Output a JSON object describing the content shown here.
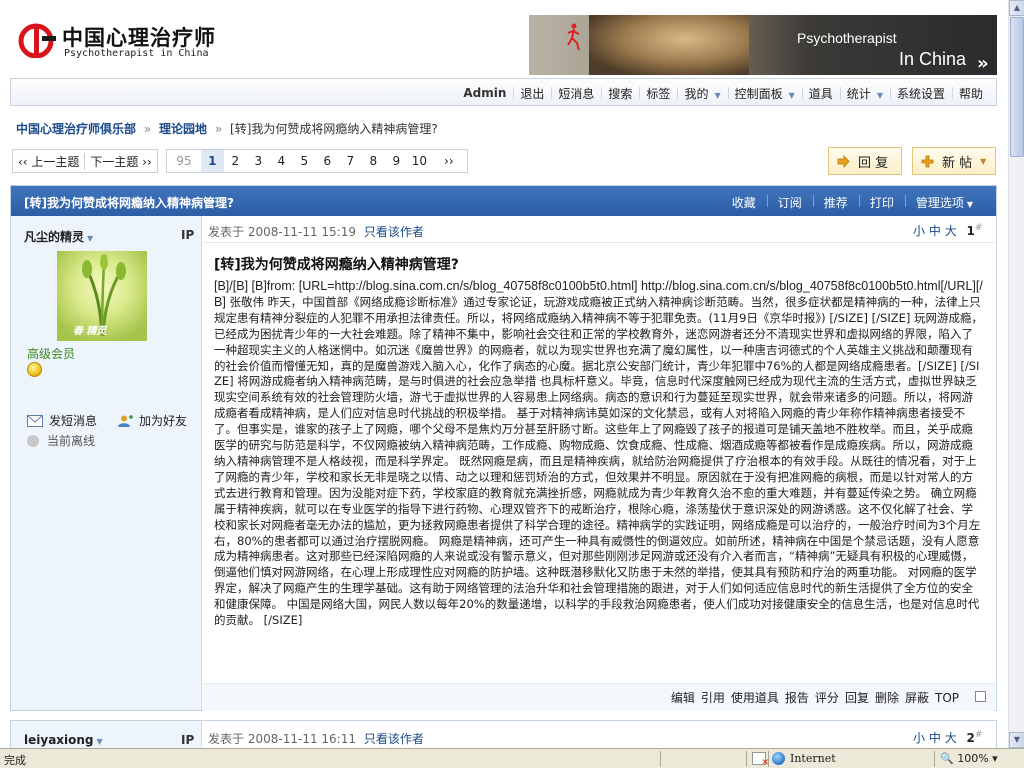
{
  "header": {
    "logo_cn": "中国心理治疗师",
    "logo_en": "Psychotherapist in China",
    "banner_line1": "Psychotherapist",
    "banner_line2": "In China",
    "banner_arrow": "»"
  },
  "menu": {
    "items": [
      "Admin",
      "退出",
      "短消息",
      "搜索",
      "标签",
      "我的",
      "控制面板",
      "道具",
      "统计",
      "系统设置",
      "帮助"
    ]
  },
  "breadcrumb": {
    "home": "中国心理治疗师俱乐部",
    "forum": "理论园地",
    "sep": "»",
    "current": "[转]我为何赞成将网瘾纳入精神病管理?"
  },
  "pager": {
    "prev_topic": "‹‹ 上一主题",
    "next_topic": "下一主题 ››",
    "pages": [
      "95",
      "1",
      "2",
      "3",
      "4",
      "5",
      "6",
      "7",
      "8",
      "9",
      "10",
      "››"
    ],
    "current_page": "1"
  },
  "buttons": {
    "reply": "回 复",
    "new_post": "新 帖"
  },
  "thread": {
    "title": "[转]我为何赞成将网瘾纳入精神病管理?",
    "actions": [
      "收藏",
      "订阅",
      "推荐",
      "打印",
      "管理选项"
    ]
  },
  "post1": {
    "author": "凡尘的精灵",
    "ip_label": "IP",
    "avatar_label": "春 精灵",
    "rank": "高级会员",
    "send_msg": "发短消息",
    "add_friend": "加为好友",
    "status": "当前离线",
    "posted_prefix": "发表于",
    "posted_time": "2008-11-11 15:19",
    "only_author": "只看该作者",
    "font_sizes": [
      "小",
      "中",
      "大"
    ],
    "floor": "1",
    "floor_mark": "#",
    "title": "[转]我为何赞成将网瘾纳入精神病管理?",
    "body_url": "[B]/[B] [B]from: [URL=http://blog.sina.com.cn/s/blog_40758f8c0100b5t0.html] http://blog.sina.com.cn/s/blog_40758f8c0100b5t0.html[/URL][/B]",
    "body": "张敬伟 昨天，中国首部《网络成瘾诊断标准》通过专家论证，玩游戏成瘾被正式纳入精神病诊断范畴。当然，很多症状都是精神病的一种，法律上只规定患有精神分裂症的人犯罪不用承担法律责任。所以，将网络成瘾纳入精神病不等于犯罪免责。(11月9日《京华时报》) [/SIZE] [/SIZE] 玩网游成瘾，已经成为困扰青少年的一大社会难题。除了精神不集中，影响社会交往和正常的学校教育外，迷恋网游者还分不清现实世界和虚拟网络的界限，陷入了一种超现实主义的人格迷惘中。如沉迷《魔兽世界》的网瘾者，就以为现实世界也充满了魔幻属性，以一种唐吉诃德式的个人英雄主义挑战和颠覆现有的社会价值而懵懂无知，真的是魔兽游戏入脑入心，化作了病态的心魔。据北京公安部门统计，青少年犯罪中76%的人都是网络成瘾患者。[/SIZE] [/SIZE] 将网游成瘾者纳入精神病范畴，是与时俱进的社会应急举措 也具标杆意义。毕竟，信息时代深度触网已经成为现代主流的生活方式，虚拟世界缺乏现实空间系统有效的社会管理防火墙，游弋于虚拟世界的人容易患上网络病。病态的意识和行为蔓延至现实世界，就会带来诸多的问题。所以，将网游成瘾者看成精神病，是人们应对信息时代挑战的积极举措。 基于对精神病讳莫如深的文化禁忌，或有人对将陷入网瘾的青少年称作精神病患者接受不了。但事实是，谁家的孩子上了网瘾，哪个父母不是焦灼万分甚至肝肠寸断。这些年上了网瘾毁了孩子的报道可是铺天盖地不胜枚举。而且，关乎成瘾医学的研究与防范是科学，不仅网瘾被纳入精神病范畴，工作成瘾、购物成瘾、饮食成瘾、性成瘾、烟酒成瘾等都被看作是成瘾疾病。所以，网游成瘾纳入精神病管理不是人格歧视，而是科学界定。 既然网瘾是病，而且是精神疾病，就给防治网瘾提供了疗治根本的有效手段。从既往的情况看，对于上了网瘾的青少年，学校和家长无非是晓之以情、动之以理和惩罚矫治的方式，但效果并不明显。原因就在于没有把准网瘾的病根，而是以针对常人的方式去进行教育和管理。因为没能对症下药，学校家庭的教育就充满挫折感，网瘾就成为青少年教育久治不愈的重大难题，并有蔓延传染之势。 确立网瘾属于精神疾病，就可以在专业医学的指导下进行药物、心理双管齐下的戒断治疗，根除心瘾，涤荡蛰伏于意识深处的网游诱惑。这不仅化解了社会、学校和家长对网瘾者毫无办法的尴尬，更为拯救网瘾患者提供了科学合理的途径。精神病学的实践证明，网络成瘾是可以治疗的，一般治疗时间为3个月左右，80%的患者都可以通过治疗摆脱网瘾。 网瘾是精神病，还可产生一种具有威慑性的倒逼效应。如前所述，精神病在中国是个禁忌话题，没有人愿意成为精神病患者。这对那些已经深陷网瘾的人来说或没有警示意义，但对那些刚刚涉足网游或还没有介入者而言，“精神病”无疑具有积极的心理威慑，倒逼他们慎对网游网络，在心理上形成理性应对网瘾的防护墙。这种既潜移默化又防患于未然的举措，使其具有预防和疗治的两重功能。 对网瘾的医学界定，解决了网瘾产生的生理学基础。这有助于网络管理的法治升华和社会管理措施的跟进，对于人们如何适应信息时代的新生活提供了全方位的安全和健康保障。 中国是网络大国，网民人数以每年20%的数量递增，以科学的手段救治网瘾患者，使人们成功对接健康安全的信息生活，也是对信息时代的贡献。 [/SIZE]",
    "footer_actions": [
      "编辑",
      "引用",
      "使用道具",
      "报告",
      "评分",
      "回复",
      "删除",
      "屏蔽",
      "TOP"
    ]
  },
  "post2": {
    "author": "leiyaxiong",
    "ip_label": "IP",
    "posted_prefix": "发表于",
    "posted_time": "2008-11-11 16:11",
    "only_author": "只看该作者",
    "font_sizes": [
      "小",
      "中",
      "大"
    ],
    "floor": "2",
    "floor_mark": "#"
  },
  "statusbar": {
    "text": "完成",
    "zone": "Internet",
    "zoom": "100%"
  },
  "colors": {
    "thread_header": "#2c5ea6",
    "link": "#1a4a8a",
    "rank_green": "#3a8a22",
    "button_border": "#e3c47d"
  }
}
